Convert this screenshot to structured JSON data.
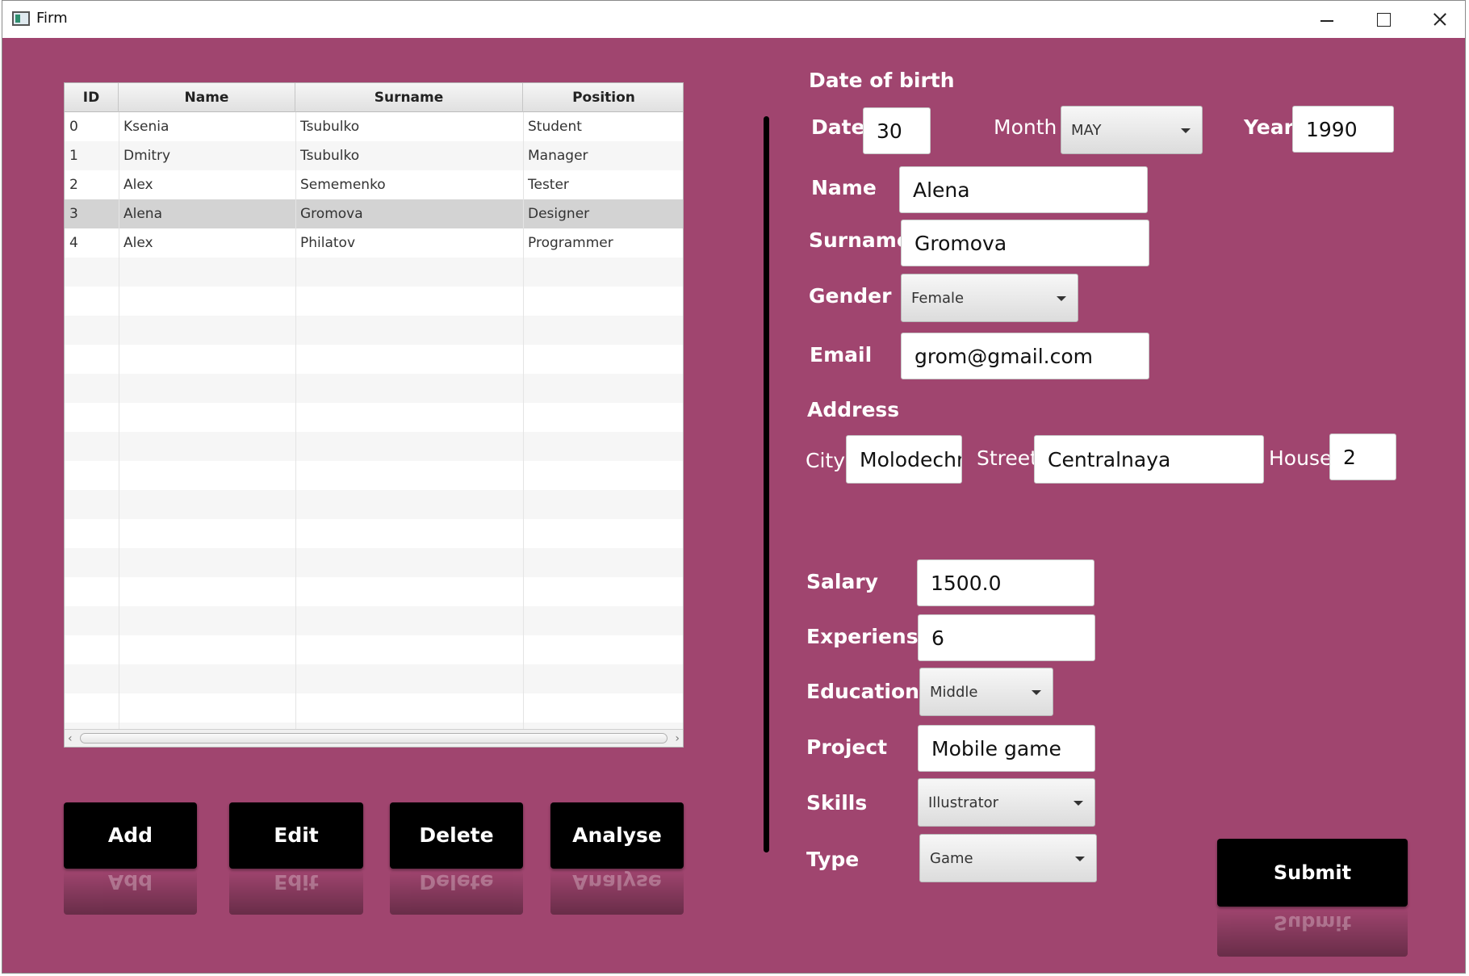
{
  "window": {
    "title": "Firm"
  },
  "table": {
    "columns": [
      "ID",
      "Name",
      "Surname",
      "Position"
    ],
    "rows": [
      [
        "0",
        "Ksenia",
        "Tsubulko",
        "Student"
      ],
      [
        "1",
        "Dmitry",
        "Tsubulko",
        "Manager"
      ],
      [
        "2",
        "Alex",
        "Sememenko",
        "Tester"
      ],
      [
        "3",
        "Alena",
        "Gromova",
        "Designer"
      ],
      [
        "4",
        "Alex",
        "Philatov",
        "Programmer"
      ]
    ],
    "selected_index": 3
  },
  "buttons": {
    "add": "Add",
    "edit": "Edit",
    "delete": "Delete",
    "analyse": "Analyse",
    "submit": "Submit"
  },
  "form": {
    "date_of_birth_label": "Date of birth",
    "date_label": "Date",
    "date_value": "30",
    "month_label": "Month",
    "month_value": "MAY",
    "year_label": "Year",
    "year_value": "1990",
    "name_label": "Name",
    "name_value": "Alena",
    "surname_label": "Surname",
    "surname_value": "Gromova",
    "gender_label": "Gender",
    "gender_value": "Female",
    "email_label": "Email",
    "email_value": "grom@gmail.com",
    "address_label": "Address",
    "city_label": "City",
    "city_value": "Molodechno",
    "street_label": "Street",
    "street_value": "Centralnaya",
    "house_label": "House",
    "house_value": "2",
    "salary_label": "Salary",
    "salary_value": "1500.0",
    "experience_label": "Experiense",
    "experience_value": "6",
    "education_label": "Education",
    "education_value": "Middle",
    "project_label": "Project",
    "project_value": "Mobile game",
    "skills_label": "Skills",
    "skills_value": "Illustrator",
    "type_label": "Type",
    "type_value": "Game"
  },
  "colors": {
    "background": "#a0456f",
    "button": "#000000",
    "selection": "#d3d3d3"
  }
}
